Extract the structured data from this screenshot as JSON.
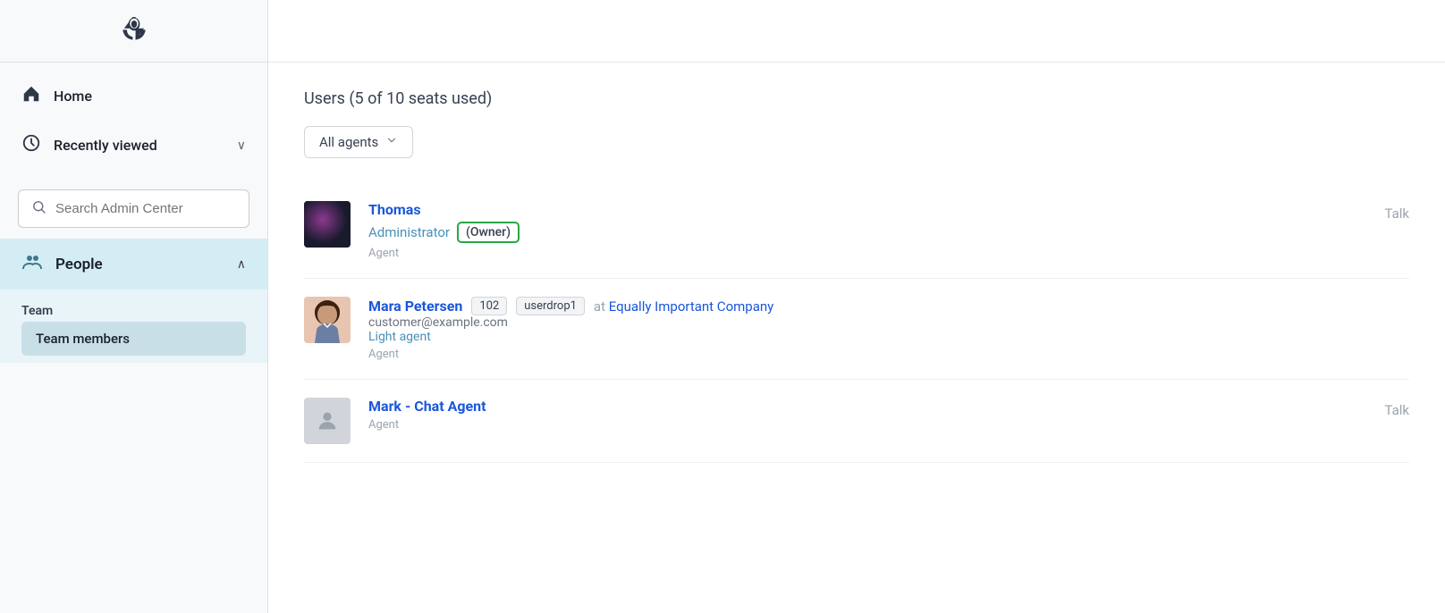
{
  "sidebar": {
    "logo_alt": "Zendesk Logo",
    "nav_items": [
      {
        "id": "home",
        "label": "Home",
        "icon": "🏠"
      },
      {
        "id": "recently-viewed",
        "label": "Recently viewed",
        "icon": "🕐",
        "has_chevron": true,
        "chevron": "∨"
      }
    ],
    "search": {
      "placeholder": "Search Admin Center"
    },
    "people": {
      "label": "People",
      "icon": "👥",
      "chevron": "∧"
    },
    "team_section": {
      "label": "Team",
      "items": [
        {
          "id": "team-members",
          "label": "Team members",
          "active": true
        }
      ]
    }
  },
  "main": {
    "users_title": "Users (5 of 10 seats used)",
    "filter": {
      "label": "All agents",
      "chevron": "∨"
    },
    "users": [
      {
        "id": "thomas",
        "name": "Thomas",
        "role_label": "Agent",
        "role": "Administrator",
        "role_suffix": "(Owner)",
        "tag": "Talk",
        "has_owner_badge": true
      },
      {
        "id": "mara-petersen",
        "name": "Mara Petersen",
        "badge_number": "102",
        "badge_tag": "userdrop1",
        "company": "Equally Important Company",
        "email": "customer@example.com",
        "role_label": "Agent",
        "role": "Light agent"
      },
      {
        "id": "mark-chat-agent",
        "name": "Mark - Chat Agent",
        "role_label": "Agent",
        "tag": "Talk"
      }
    ]
  }
}
